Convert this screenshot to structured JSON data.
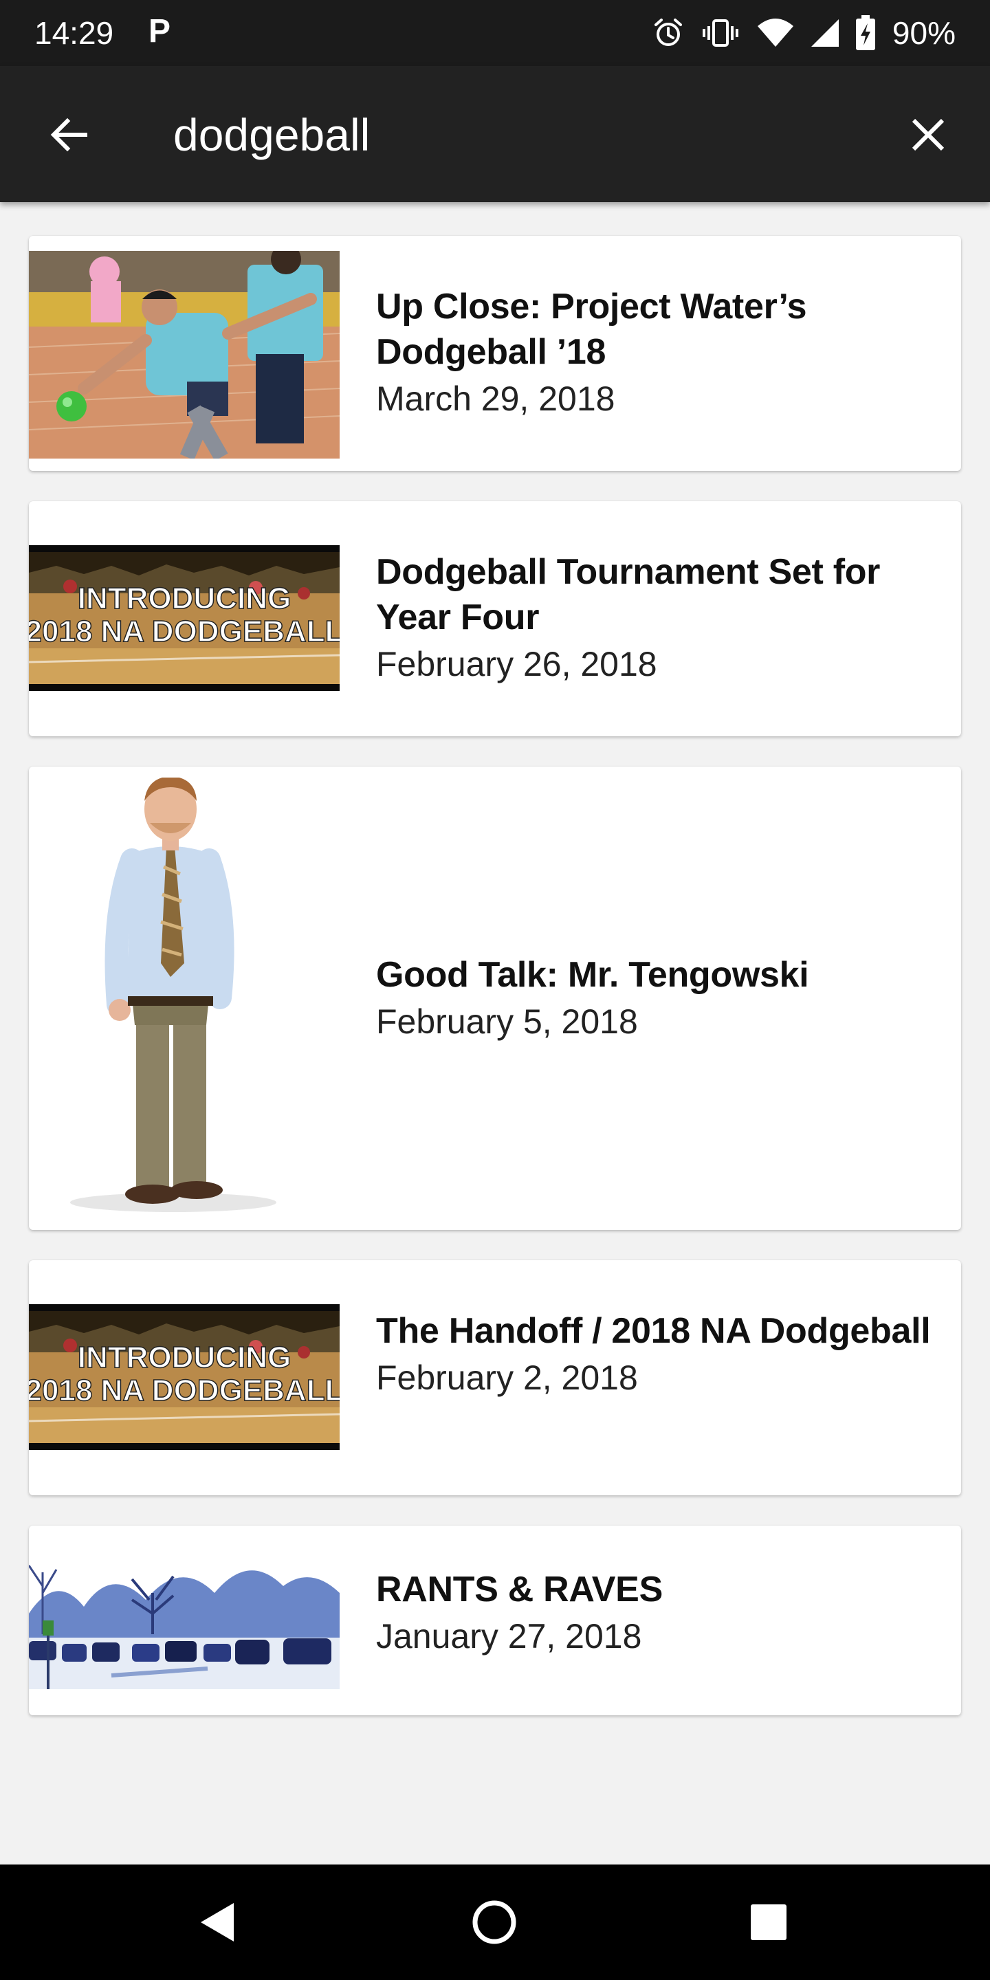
{
  "status_bar": {
    "time": "14:29",
    "notification_icon": "p-icon",
    "battery": "90%",
    "icons": [
      "alarm-icon",
      "vibrate-icon",
      "wifi-icon",
      "cell-signal-icon",
      "battery-charging-icon"
    ]
  },
  "app_bar": {
    "query": "dodgeball",
    "back_icon": "arrow-back-icon",
    "clear_icon": "close-icon",
    "background": "#222222"
  },
  "results": [
    {
      "title": "Up Close: Project Water’s Dodgeball ’18",
      "date": "March 29, 2018",
      "thumbnail": "dodgeball-player-throwing-photo"
    },
    {
      "title": "Dodgeball Tournament Set for Year Four",
      "date": "February 26, 2018",
      "thumbnail": "introducing-dodgeball-video-thumbnail",
      "thumbnail_text": [
        "INTRODUCING",
        "2018 NA DODGEBALL"
      ]
    },
    {
      "title": "Good Talk: Mr. Tengowski",
      "date": "February 5, 2018",
      "thumbnail": "teacher-portrait-photo"
    },
    {
      "title": "The Handoff / 2018 NA Dodgeball",
      "date": "February 2, 2018",
      "thumbnail": "introducing-dodgeball-video-thumbnail",
      "thumbnail_text": [
        "INTRODUCING",
        "2018 NA DODGEBALL"
      ]
    },
    {
      "title": "RANTS & RAVES",
      "date": "January 27, 2018",
      "thumbnail": "snowy-parking-lot-photo"
    }
  ],
  "nav_bar": {
    "back": "nav-back-icon",
    "home": "nav-home-icon",
    "recents": "nav-recents-icon"
  }
}
